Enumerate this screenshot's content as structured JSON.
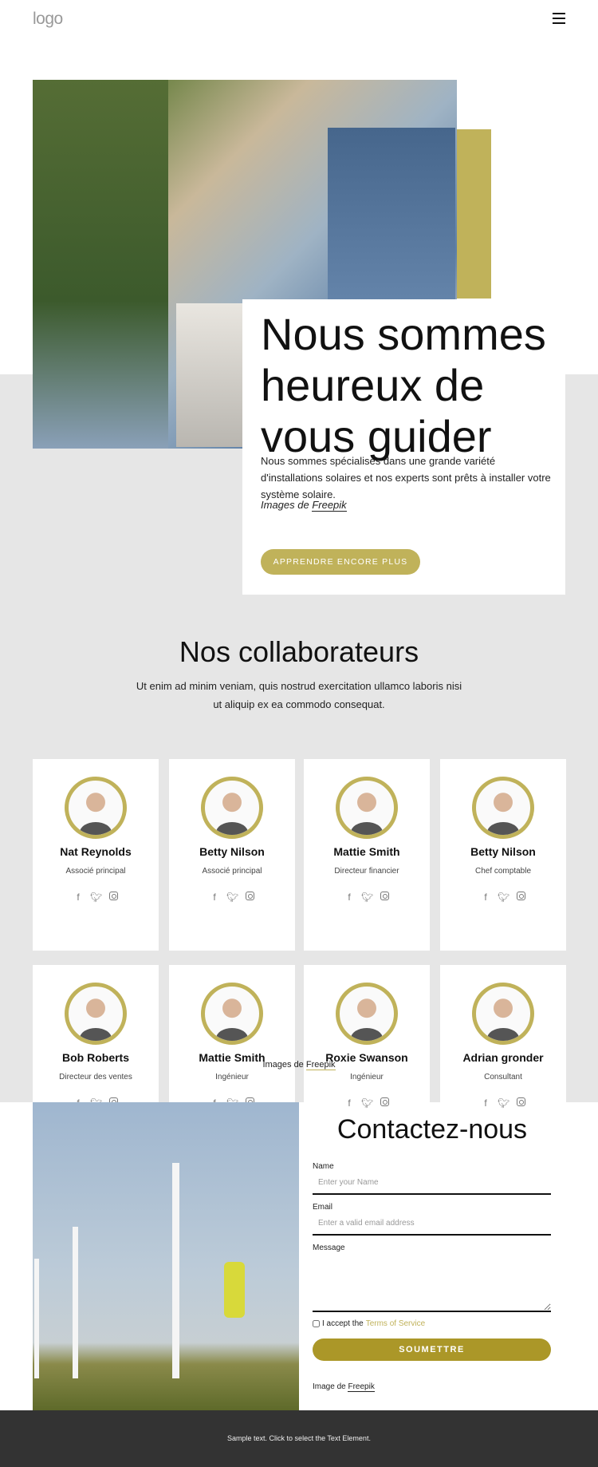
{
  "header": {
    "logo": "logo",
    "menu_icon": "hamburger-icon"
  },
  "hero": {
    "title": "Nous sommes heureux de vous guider",
    "text": "Nous sommes spécialisés dans une grande variété d'installations solaires et nos experts sont prêts à installer votre système solaire.",
    "credit_prefix": "Images de",
    "credit_link": "Freepik",
    "button": "APPRENDRE ENCORE PLUS"
  },
  "team": {
    "title": "Nos collaborateurs",
    "subtitle": "Ut enim ad minim veniam, quis nostrud exercitation ullamco laboris nisi ut aliquip ex ea commodo consequat.",
    "members": [
      {
        "name": "Nat Reynolds",
        "role": "Associé principal"
      },
      {
        "name": "Betty Nilson",
        "role": "Associé principal"
      },
      {
        "name": "Mattie Smith",
        "role": "Directeur financier"
      },
      {
        "name": "Betty Nilson",
        "role": "Chef comptable"
      },
      {
        "name": "Bob Roberts",
        "role": "Directeur des ventes"
      },
      {
        "name": "Mattie Smith",
        "role": "Ingénieur"
      },
      {
        "name": "Roxie Swanson",
        "role": "Ingénieur"
      },
      {
        "name": "Adrian gronder",
        "role": "Consultant"
      }
    ],
    "credit_prefix": "Images de",
    "credit_link": "Freepik"
  },
  "contact": {
    "title": "Contactez-nous",
    "name_label": "Name",
    "name_placeholder": "Enter your Name",
    "email_label": "Email",
    "email_placeholder": "Enter a valid email address",
    "message_label": "Message",
    "accept_prefix": "I accept the",
    "accept_link": "Terms of Service",
    "submit": "SOUMETTRE",
    "credit_prefix": "Image de",
    "credit_link": "Freepik"
  },
  "footer": {
    "text": "Sample text. Click to select the Text Element."
  },
  "colors": {
    "accent": "#c0b25a",
    "submit": "#ab9728",
    "section_bg": "#e6e6e6",
    "footer_bg": "#333333"
  }
}
